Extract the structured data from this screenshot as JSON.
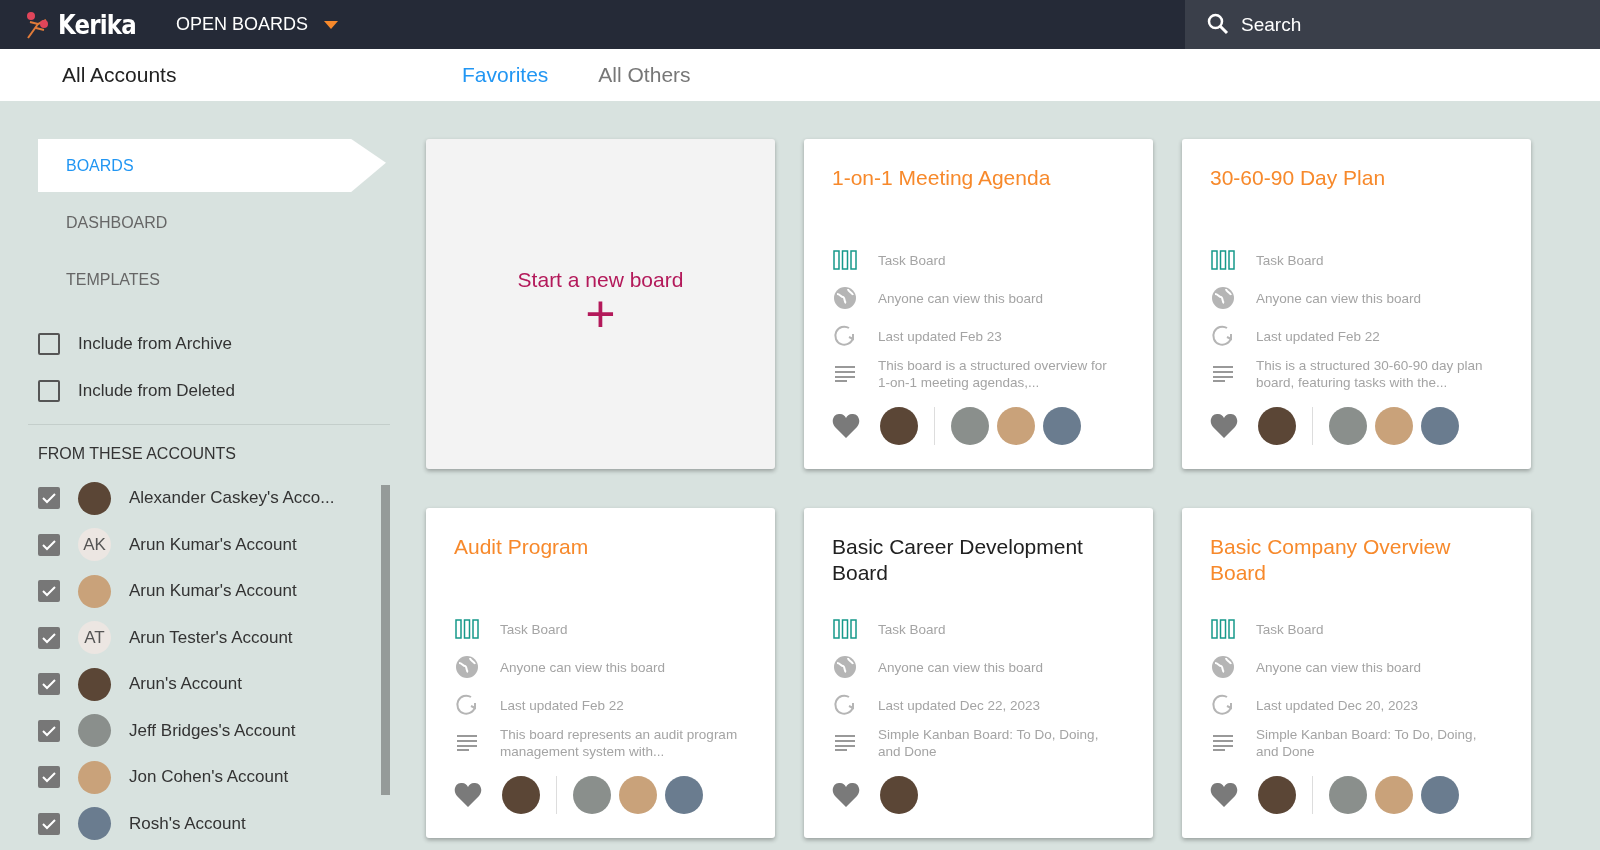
{
  "header": {
    "logo": "Kerika",
    "menu": "OPEN BOARDS",
    "search": {
      "placeholder": "Search"
    }
  },
  "subheader": {
    "account": "All Accounts",
    "tabs": [
      {
        "label": "Favorites",
        "selected": true
      },
      {
        "label": "All Others",
        "selected": false
      }
    ]
  },
  "sidebar": {
    "nav": [
      {
        "label": "BOARDS",
        "selected": true
      },
      {
        "label": "DASHBOARD",
        "selected": false
      },
      {
        "label": "TEMPLATES",
        "selected": false
      }
    ],
    "filters": [
      {
        "label": "Include from Archive",
        "checked": false
      },
      {
        "label": "Include from Deleted",
        "checked": false
      }
    ],
    "accounts_heading": "FROM THESE ACCOUNTS",
    "accounts": [
      {
        "name": "Alexander Caskey's Acco...",
        "checked": true,
        "avatar": {
          "kind": "photo"
        }
      },
      {
        "name": "Arun Kumar's Account",
        "checked": true,
        "avatar": {
          "kind": "initials",
          "text": "AK"
        }
      },
      {
        "name": "Arun Kumar's Account",
        "checked": true,
        "avatar": {
          "kind": "photo"
        }
      },
      {
        "name": "Arun Tester's Account",
        "checked": true,
        "avatar": {
          "kind": "initials",
          "text": "AT"
        }
      },
      {
        "name": "Arun's Account",
        "checked": true,
        "avatar": {
          "kind": "photo"
        }
      },
      {
        "name": "Jeff Bridges's Account",
        "checked": true,
        "avatar": {
          "kind": "photo"
        }
      },
      {
        "name": "Jon Cohen's Account",
        "checked": true,
        "avatar": {
          "kind": "photo"
        }
      },
      {
        "name": "Rosh's Account",
        "checked": true,
        "avatar": {
          "kind": "photo"
        }
      }
    ]
  },
  "new_board": {
    "label": "Start a new board",
    "icon": "+"
  },
  "boards": [
    {
      "title": "1-on-1 Meeting Agenda",
      "color": "#f7892b",
      "type": "Task Board",
      "visibility": "Anyone can view this board",
      "updated": "Last updated Feb 23",
      "description": "This board is a structured overview for 1-on-1 meeting agendas,...",
      "owner": {
        "kind": "photo"
      },
      "members": [
        {
          "kind": "photo"
        },
        {
          "kind": "photo"
        },
        {
          "kind": "photo"
        }
      ]
    },
    {
      "title": "30-60-90 Day Plan",
      "color": "#f7892b",
      "type": "Task Board",
      "visibility": "Anyone can view this board",
      "updated": "Last updated Feb 22",
      "description": "This is a structured 30-60-90 day plan board, featuring tasks with the...",
      "owner": {
        "kind": "photo"
      },
      "members": [
        {
          "kind": "photo"
        },
        {
          "kind": "photo"
        },
        {
          "kind": "photo"
        }
      ]
    },
    {
      "title": "Audit Program",
      "color": "#f7892b",
      "type": "Task Board",
      "visibility": "Anyone can view this board",
      "updated": "Last updated Feb 22",
      "description": "This board represents an audit program management system with...",
      "owner": {
        "kind": "photo"
      },
      "members": [
        {
          "kind": "photo"
        },
        {
          "kind": "photo"
        },
        {
          "kind": "photo"
        }
      ]
    },
    {
      "title": "Basic Career Development Board",
      "color": "#212121",
      "type": "Task Board",
      "visibility": "Anyone can view this board",
      "updated": "Last updated Dec 22, 2023",
      "description": "Simple Kanban Board: To Do, Doing, and Done",
      "owner": {
        "kind": "photo"
      }
    },
    {
      "title": "Basic Company Overview Board",
      "color": "#f7892b",
      "type": "Task Board",
      "visibility": "Anyone can view this board",
      "updated": "Last updated Dec 20, 2023",
      "description": "Simple Kanban Board: To Do, Doing, and Done",
      "owner": {
        "kind": "photo"
      },
      "members": [
        {
          "kind": "photo"
        },
        {
          "kind": "photo"
        },
        {
          "kind": "photo"
        }
      ]
    }
  ]
}
